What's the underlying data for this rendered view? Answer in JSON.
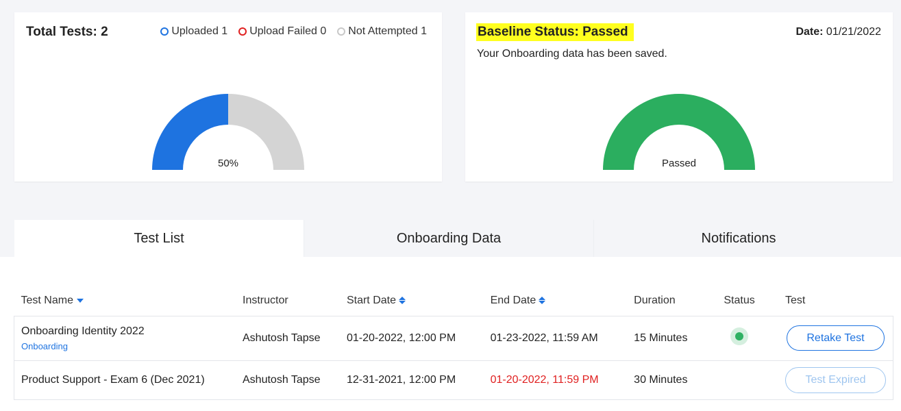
{
  "summary": {
    "total_label": "Total Tests: 2",
    "legend": [
      {
        "label": "Uploaded 1",
        "color": "#1e73e0",
        "icon": "circle-outline-icon"
      },
      {
        "label": "Upload Failed 0",
        "color": "#e02020",
        "icon": "circle-outline-icon"
      },
      {
        "label": "Not Attempted 1",
        "color": "#c8c8c8",
        "icon": "circle-outline-icon"
      }
    ],
    "gauge_label": "50%",
    "gauge_value": 0.5,
    "gauge_colors": {
      "filled": "#1e73e0",
      "empty": "#d4d4d4"
    }
  },
  "baseline": {
    "title": "Baseline Status: Passed",
    "date_label": "Date:",
    "date_value": "01/21/2022",
    "message": "Your Onboarding data has been saved.",
    "gauge_label": "Passed",
    "gauge_value": 1.0,
    "gauge_color": "#2bae5f",
    "highlight_color": "#ffff1f"
  },
  "tabs": [
    {
      "label": "Test List",
      "active": true
    },
    {
      "label": "Onboarding Data",
      "active": false
    },
    {
      "label": "Notifications",
      "active": false
    }
  ],
  "table": {
    "headers": {
      "name": "Test Name",
      "instructor": "Instructor",
      "start": "Start Date",
      "end": "End Date",
      "duration": "Duration",
      "status": "Status",
      "test": "Test"
    },
    "rows": [
      {
        "name": "Onboarding Identity 2022",
        "tag": "Onboarding",
        "instructor": "Ashutosh Tapse",
        "start": "01-20-2022, 12:00 PM",
        "end": "01-23-2022, 11:59 AM",
        "duration": "15 Minutes",
        "status": "active",
        "action": "Retake Test"
      },
      {
        "name": "Product Support - Exam 6 (Dec 2021)",
        "instructor": "Ashutosh Tapse",
        "start": "12-31-2021, 12:00 PM",
        "end": "01-20-2022, 11:59 PM",
        "duration": "30 Minutes",
        "action": "Test Expired"
      }
    ]
  }
}
